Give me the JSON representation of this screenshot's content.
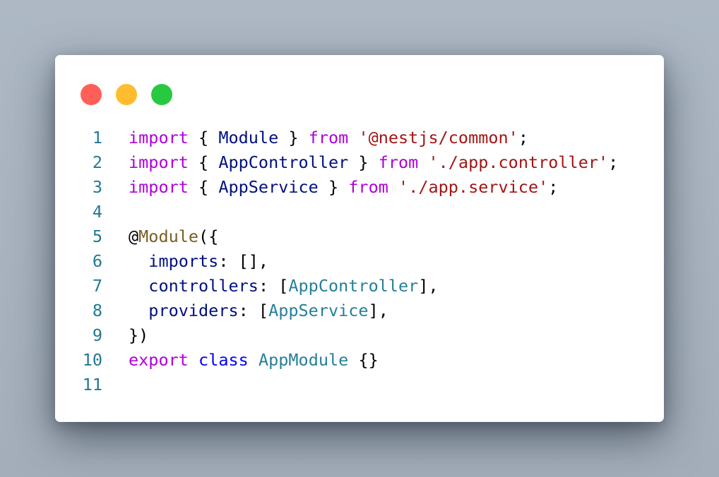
{
  "window": {
    "traffic_lights": {
      "close": "#ff5f57",
      "minimize": "#febc2e",
      "maximize": "#28c840"
    }
  },
  "colors": {
    "keyword": "#af00db",
    "storage_keyword": "#0000ff",
    "string": "#a31515",
    "identifier": "#001080",
    "type": "#267f99",
    "decorator": "#795e26",
    "line_number": "#237893"
  },
  "code": {
    "language": "typescript",
    "lines": [
      {
        "number": "1",
        "tokens": [
          {
            "text": "import",
            "kind": "kw"
          },
          {
            "text": " { ",
            "kind": "plain"
          },
          {
            "text": "Module",
            "kind": "ident"
          },
          {
            "text": " } ",
            "kind": "plain"
          },
          {
            "text": "from",
            "kind": "kw"
          },
          {
            "text": " ",
            "kind": "plain"
          },
          {
            "text": "'@nestjs/common'",
            "kind": "str"
          },
          {
            "text": ";",
            "kind": "plain"
          }
        ]
      },
      {
        "number": "2",
        "tokens": [
          {
            "text": "import",
            "kind": "kw"
          },
          {
            "text": " { ",
            "kind": "plain"
          },
          {
            "text": "AppController",
            "kind": "ident"
          },
          {
            "text": " } ",
            "kind": "plain"
          },
          {
            "text": "from",
            "kind": "kw"
          },
          {
            "text": " ",
            "kind": "plain"
          },
          {
            "text": "'./app.controller'",
            "kind": "str"
          },
          {
            "text": ";",
            "kind": "plain"
          }
        ]
      },
      {
        "number": "3",
        "tokens": [
          {
            "text": "import",
            "kind": "kw"
          },
          {
            "text": " { ",
            "kind": "plain"
          },
          {
            "text": "AppService",
            "kind": "ident"
          },
          {
            "text": " } ",
            "kind": "plain"
          },
          {
            "text": "from",
            "kind": "kw"
          },
          {
            "text": " ",
            "kind": "plain"
          },
          {
            "text": "'./app.service'",
            "kind": "str"
          },
          {
            "text": ";",
            "kind": "plain"
          }
        ]
      },
      {
        "number": "4",
        "tokens": []
      },
      {
        "number": "5",
        "tokens": [
          {
            "text": "@",
            "kind": "plain"
          },
          {
            "text": "Module",
            "kind": "deco"
          },
          {
            "text": "({",
            "kind": "plain"
          }
        ]
      },
      {
        "number": "6",
        "tokens": [
          {
            "text": "  ",
            "kind": "plain"
          },
          {
            "text": "imports",
            "kind": "ident"
          },
          {
            "text": ": [],",
            "kind": "plain"
          }
        ]
      },
      {
        "number": "7",
        "tokens": [
          {
            "text": "  ",
            "kind": "plain"
          },
          {
            "text": "controllers",
            "kind": "ident"
          },
          {
            "text": ": [",
            "kind": "plain"
          },
          {
            "text": "AppController",
            "kind": "type"
          },
          {
            "text": "],",
            "kind": "plain"
          }
        ]
      },
      {
        "number": "8",
        "tokens": [
          {
            "text": "  ",
            "kind": "plain"
          },
          {
            "text": "providers",
            "kind": "ident"
          },
          {
            "text": ": [",
            "kind": "plain"
          },
          {
            "text": "AppService",
            "kind": "type"
          },
          {
            "text": "],",
            "kind": "plain"
          }
        ]
      },
      {
        "number": "9",
        "tokens": [
          {
            "text": "})",
            "kind": "plain"
          }
        ]
      },
      {
        "number": "10",
        "tokens": [
          {
            "text": "export",
            "kind": "kw"
          },
          {
            "text": " ",
            "kind": "plain"
          },
          {
            "text": "class",
            "kind": "kw2"
          },
          {
            "text": " ",
            "kind": "plain"
          },
          {
            "text": "AppModule",
            "kind": "type"
          },
          {
            "text": " {}",
            "kind": "plain"
          }
        ]
      },
      {
        "number": "11",
        "tokens": []
      }
    ]
  }
}
